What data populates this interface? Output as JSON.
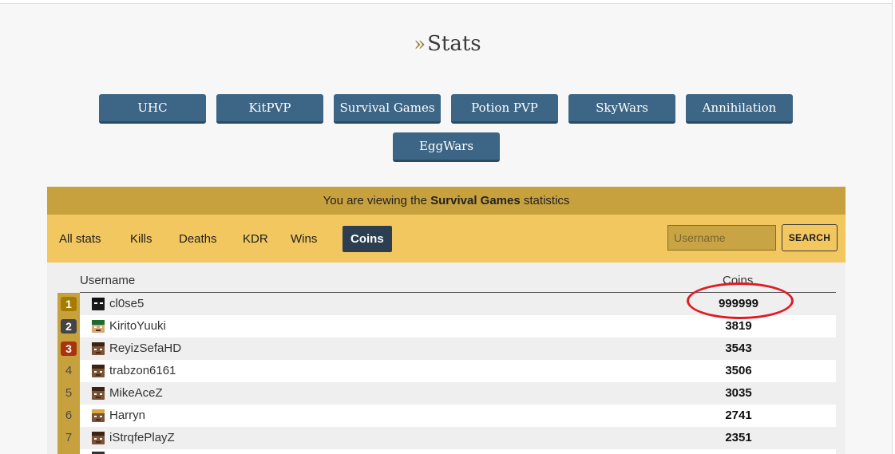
{
  "page": {
    "title": "Stats",
    "title_prefix": "»"
  },
  "games": [
    "UHC",
    "KitPVP",
    "Survival Games",
    "Potion PVP",
    "SkyWars",
    "Annihilation",
    "EggWars"
  ],
  "banner": {
    "prefix": "You are viewing the ",
    "game": "Survival Games",
    "suffix": " statistics"
  },
  "filters": {
    "tabs": [
      "All stats",
      "Kills",
      "Deaths",
      "KDR",
      "Wins",
      "Coins"
    ],
    "active": "Coins",
    "search_placeholder": "Username",
    "search_label": "SEARCH"
  },
  "table": {
    "headers": {
      "username": "Username",
      "coins": "Coins"
    },
    "rows": [
      {
        "rank": "1",
        "username": "cl0se5",
        "coins": "999999"
      },
      {
        "rank": "2",
        "username": "KiritoYuuki",
        "coins": "3819"
      },
      {
        "rank": "3",
        "username": "ReyizSefaHD",
        "coins": "3543"
      },
      {
        "rank": "4",
        "username": "trabzon6161",
        "coins": "3506"
      },
      {
        "rank": "5",
        "username": "MikeAceZ",
        "coins": "3035"
      },
      {
        "rank": "6",
        "username": "Harryn",
        "coins": "2741"
      },
      {
        "rank": "7",
        "username": "iStrqfePlayZ",
        "coins": "2351"
      }
    ]
  },
  "colors": {
    "button": "#3d6686",
    "banner": "#c8a13f",
    "filter_bar": "#f3c75f",
    "active_tab": "#2c3e50",
    "gold": "#a67c00",
    "silver": "#444444",
    "bronze": "#a8330f",
    "highlight": "#e01b24"
  }
}
